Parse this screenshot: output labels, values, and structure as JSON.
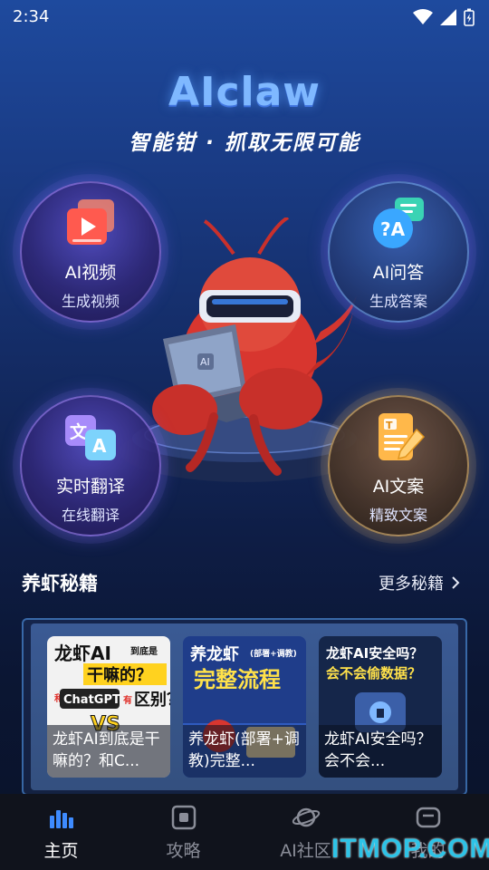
{
  "status_bar": {
    "time": "2:34"
  },
  "header": {
    "brand": "AIclaw",
    "slogan": "智能钳 · 抓取无限可能"
  },
  "features": [
    {
      "title": "AI视频",
      "subtitle": "生成视频",
      "icon": "video-icon"
    },
    {
      "title": "AI问答",
      "subtitle": "生成答案",
      "icon": "qa-chat-icon"
    },
    {
      "title": "实时翻译",
      "subtitle": "在线翻译",
      "icon": "translate-icon"
    },
    {
      "title": "AI文案",
      "subtitle": "精致文案",
      "icon": "document-edit-icon"
    }
  ],
  "mascot": {
    "laptop_label": "AI"
  },
  "section": {
    "title": "养虾秘籍",
    "more": "更多秘籍"
  },
  "cards": [
    {
      "caption": "龙虾AI到底是干嘛的？和C...",
      "cover_lines": [
        "龙虾AI",
        "到底是",
        "干嘛的？",
        "和",
        "ChatGPT",
        "有",
        "区别？",
        "VS"
      ]
    },
    {
      "caption": "养龙虾(部署+调教)完整...",
      "cover_lines": [
        "养龙虾",
        "(部署+调教)",
        "完整流程"
      ]
    },
    {
      "caption": "龙虾AI安全吗？会不会...",
      "cover_lines": [
        "龙虾AI安全吗？",
        "会不会偷数据？"
      ]
    }
  ],
  "tabs": [
    {
      "label": "主页",
      "active": true
    },
    {
      "label": "攻略",
      "active": false
    },
    {
      "label": "AI社区",
      "active": false
    },
    {
      "label": "我的",
      "active": false
    }
  ],
  "watermark": "ITMOP.COM",
  "colors": {
    "accent": "#7fb8ff",
    "tab_bg": "#10131c",
    "watermark": "#2ec3e6"
  }
}
